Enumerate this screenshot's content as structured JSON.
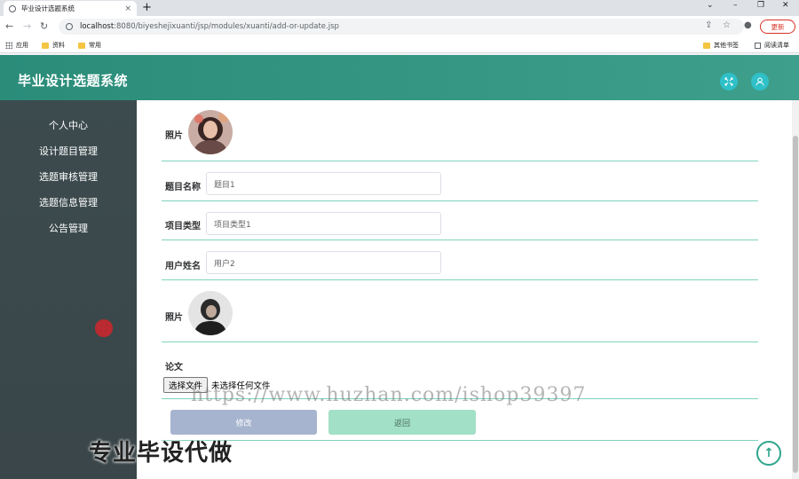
{
  "browser": {
    "tab_title": "毕业设计选题系统",
    "tab_close": "×",
    "new_tab": "+",
    "url_host": "localhost",
    "url_rest": ":8080/biyeshejixuanti/jsp/modules/xuanti/add-or-update.jsp",
    "update_label": "更新",
    "window_controls": [
      "⌄",
      "–",
      "❐",
      "✕"
    ],
    "bookmarks": {
      "apps": "应用",
      "items": [
        "资料",
        "常用"
      ],
      "right_items": [
        "其他书签",
        "阅读清单"
      ]
    }
  },
  "app": {
    "title": "毕业设计选题系统",
    "header_icons": [
      "fullscreen-icon",
      "user-icon"
    ],
    "accent_color": "#2a8c79"
  },
  "sidebar": {
    "items": [
      {
        "label": "个人中心"
      },
      {
        "label": "设计题目管理"
      },
      {
        "label": "选题审核管理"
      },
      {
        "label": "选题信息管理"
      },
      {
        "label": "公告管理"
      }
    ]
  },
  "form": {
    "photo1_label": "照片",
    "title_label": "题目名称",
    "title_value": "题目1",
    "type_label": "项目类型",
    "type_value": "项目类型1",
    "user_label": "用户姓名",
    "user_value": "用户2",
    "photo2_label": "照片",
    "paper_label": "论文",
    "file_button": "选择文件",
    "file_status": "未选择任何文件",
    "edit_button": "修改",
    "back_button": "返回"
  },
  "overlay": {
    "watermark": "https://www.huzhan.com/ishop39397",
    "promo": "专业毕设代做"
  }
}
